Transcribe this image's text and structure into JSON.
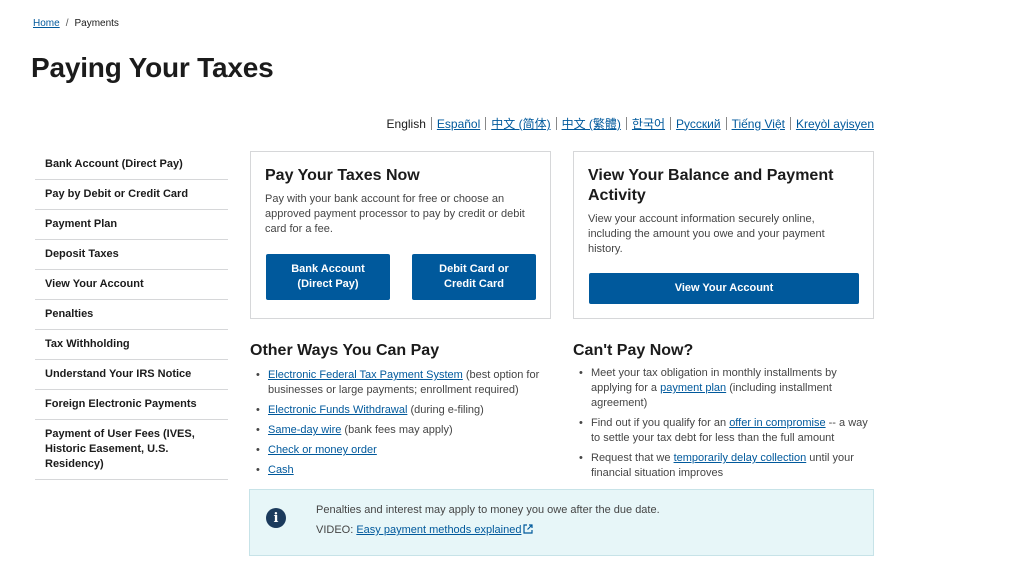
{
  "breadcrumb": {
    "home": "Home",
    "separator": "/",
    "current": "Payments"
  },
  "page": {
    "title": "Paying Your Taxes"
  },
  "languages": {
    "current": "English",
    "links": [
      "Español",
      "中文 (简体)",
      "中文 (繁體)",
      "한국어",
      "Русский",
      "Tiếng Việt",
      "Kreyòl ayisyen"
    ]
  },
  "sidenav": {
    "items": [
      "Bank Account (Direct Pay)",
      "Pay by Debit or Credit Card",
      "Payment Plan",
      "Deposit Taxes",
      "View Your Account",
      "Penalties",
      "Tax Withholding",
      "Understand Your IRS Notice",
      "Foreign Electronic Payments",
      "Payment of User Fees (IVES, Historic Easement, U.S. Residency)"
    ]
  },
  "pay_card": {
    "title": "Pay Your Taxes Now",
    "text": "Pay with your bank account for free or choose an approved payment processor to pay by credit or debit card for a fee.",
    "btn_bank": "Bank Account (Direct Pay)",
    "btn_card": "Debit Card or Credit Card"
  },
  "view_card": {
    "title": "View Your Balance and Payment Activity",
    "text": "View your account information securely online, including the amount you owe and your payment history.",
    "btn": "View Your Account"
  },
  "other_ways": {
    "title": "Other Ways You Can Pay",
    "items": [
      {
        "link": "Electronic Federal Tax Payment System",
        "rest": " (best option for businesses or large payments; enrollment required)"
      },
      {
        "link": "Electronic Funds Withdrawal",
        "rest": " (during e-filing)"
      },
      {
        "link": "Same-day wire",
        "rest": " (bank fees may apply)"
      },
      {
        "link": "Check or money order",
        "rest": ""
      },
      {
        "link": "Cash",
        "rest": ""
      }
    ]
  },
  "cant_pay": {
    "title": "Can't Pay Now?",
    "items": [
      {
        "pre": "Meet your tax obligation in monthly installments by applying for a ",
        "link": "payment plan",
        "post": " (including installment agreement)"
      },
      {
        "pre": "Find out if you qualify for an ",
        "link": "offer in compromise",
        "post": " -- a way to settle your tax debt for less than the full amount"
      },
      {
        "pre": "Request that we ",
        "link": "temporarily delay collection",
        "post": " until your financial situation improves"
      }
    ]
  },
  "alert": {
    "icon": "info-icon",
    "text": "Penalties and interest may apply to money you owe after the due date.",
    "video_label": "VIDEO: ",
    "video_link": "Easy payment methods explained"
  },
  "colors": {
    "primary": "#00599c",
    "alert_bg": "#e7f6f8",
    "border": "#d6d7d9"
  }
}
